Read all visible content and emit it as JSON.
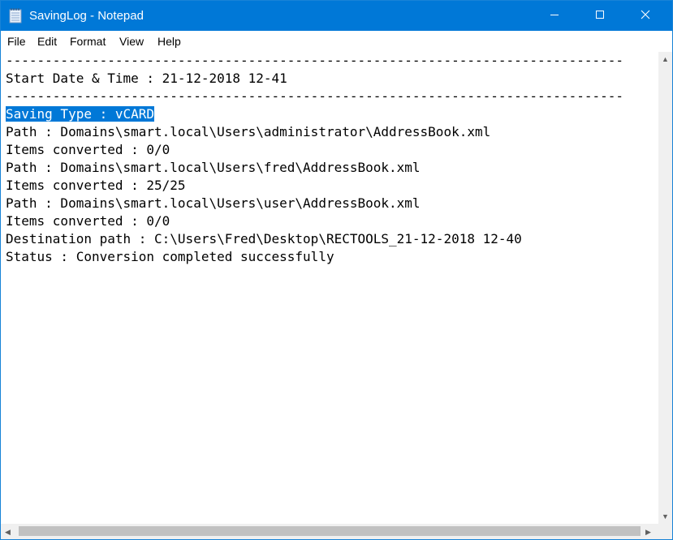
{
  "window": {
    "title": "SavingLog - Notepad"
  },
  "menu": {
    "items": [
      "File",
      "Edit",
      "Format",
      "View",
      "Help"
    ]
  },
  "document": {
    "lines": [
      "-------------------------------------------------------------------------------",
      "Start Date & Time : 21-12-2018 12-41",
      "-------------------------------------------------------------------------------",
      "Saving Type : vCARD",
      "Path : Domains\\smart.local\\Users\\administrator\\AddressBook.xml",
      "Items converted : 0/0",
      "Path : Domains\\smart.local\\Users\\fred\\AddressBook.xml",
      "Items converted : 25/25",
      "Path : Domains\\smart.local\\Users\\user\\AddressBook.xml",
      "Items converted : 0/0",
      "Destination path : C:\\Users\\Fred\\Desktop\\RECTOOLS_21-12-2018 12-40",
      "Status : Conversion completed successfully"
    ],
    "selected_line_index": 3
  },
  "icons": {
    "app": "notepad-icon",
    "minimize": "minimize-icon",
    "maximize": "maximize-icon",
    "close": "close-icon"
  },
  "colors": {
    "titlebar": "#0078d7",
    "selection": "#0078d7"
  }
}
